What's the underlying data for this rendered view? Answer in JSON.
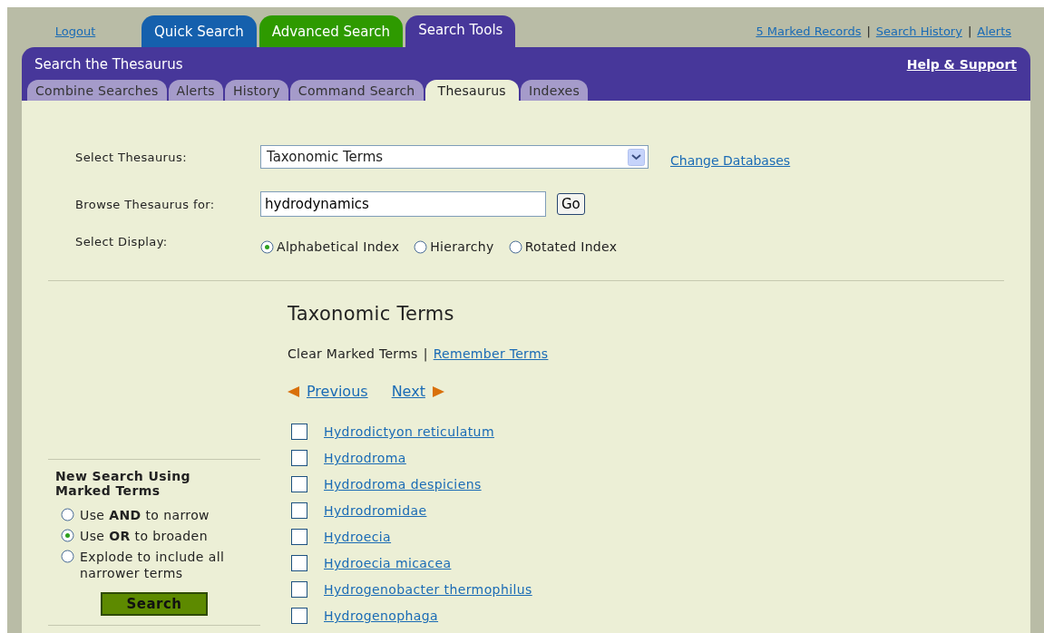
{
  "top_links_left": [
    "Logout"
  ],
  "main_tabs": [
    {
      "label": "Quick Search",
      "color": "#1560ad",
      "selected": false
    },
    {
      "label": "Advanced Search",
      "color": "#2e9a00",
      "selected": false
    },
    {
      "label": "Search Tools",
      "color": "#47379a",
      "selected": true
    }
  ],
  "top_links_right": [
    "5 Marked Records",
    "Search History",
    "Alerts"
  ],
  "top_links_separator": "|",
  "panel": {
    "title": "Search the Thesaurus",
    "help_link": "Help & Support"
  },
  "sub_tabs": [
    {
      "label": "Combine Searches",
      "selected": false
    },
    {
      "label": "Alerts",
      "selected": false
    },
    {
      "label": "History",
      "selected": false
    },
    {
      "label": "Command Search",
      "selected": false
    },
    {
      "label": "Thesaurus",
      "selected": true
    },
    {
      "label": "Indexes",
      "selected": false
    }
  ],
  "form": {
    "thesaurus_label": "Select Thesaurus:",
    "thesaurus_value": "Taxonomic Terms",
    "change_link": "Change Databases",
    "browse_label": "Browse Thesaurus for:",
    "browse_value": "hydrodynamics",
    "go_button": "Go",
    "display_label": "Select Display:",
    "display_options": [
      {
        "label": "Alphabetical Index",
        "selected": true
      },
      {
        "label": "Hierarchy",
        "selected": false
      },
      {
        "label": "Rotated Index",
        "selected": false
      }
    ]
  },
  "results": {
    "heading": "Taxonomic Terms",
    "clear_text": "Clear Marked Terms",
    "separator": "|",
    "remember_link": "Remember Terms",
    "previous_link": "Previous",
    "next_link": "Next",
    "terms": [
      {
        "label": "Hydrodictyon reticulatum",
        "checked": false
      },
      {
        "label": "Hydrodroma",
        "checked": false
      },
      {
        "label": "Hydrodroma despiciens",
        "checked": false
      },
      {
        "label": "Hydrodromidae",
        "checked": false
      },
      {
        "label": "Hydroecia",
        "checked": false
      },
      {
        "label": "Hydroecia micacea",
        "checked": false
      },
      {
        "label": "Hydrogenobacter thermophilus",
        "checked": false
      },
      {
        "label": "Hydrogenophaga",
        "checked": false
      }
    ]
  },
  "sidebar": {
    "title": "New Search Using Marked Terms",
    "options": [
      {
        "label": "Use **AND** to narrow",
        "selected": false
      },
      {
        "label": "Use **OR** to broaden",
        "selected": true
      },
      {
        "label": "Explode to include all narrower terms",
        "selected": false
      }
    ],
    "search_button": "Search"
  }
}
